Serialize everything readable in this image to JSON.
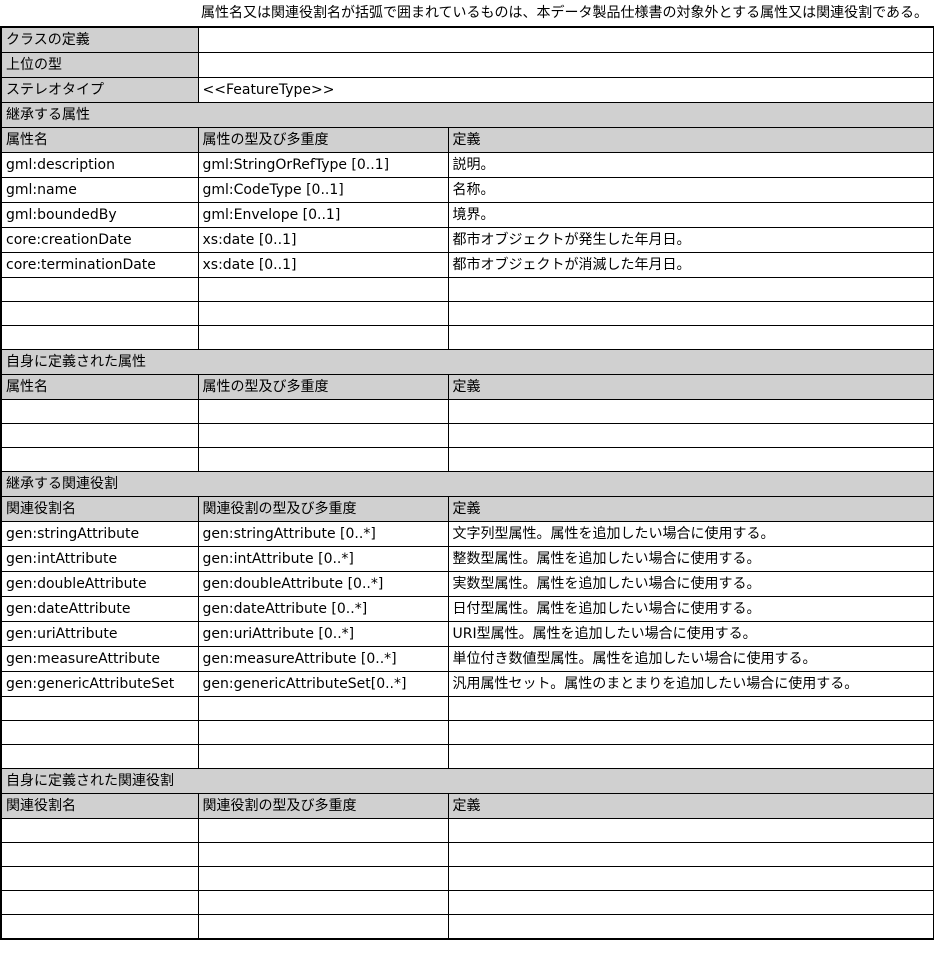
{
  "note": "属性名又は関連役割名が括弧で囲まれているものは、本データ製品仕様書の対象外とする属性又は関連役割である。",
  "class_definition_label": "クラスの定義",
  "class_definition_value": "",
  "supertype_label": "上位の型",
  "supertype_value": "",
  "stereotype_label": "ステレオタイプ",
  "stereotype_value": "<<FeatureType>>",
  "inherited_attributes": {
    "section_title": "継承する属性",
    "headers": [
      "属性名",
      "属性の型及び多重度",
      "定義"
    ],
    "rows": [
      [
        "gml:description",
        "gml:StringOrRefType [0..1]",
        "説明。"
      ],
      [
        "gml:name",
        "gml:CodeType [0..1]",
        "名称。"
      ],
      [
        "gml:boundedBy",
        "gml:Envelope [0..1]",
        "境界。"
      ],
      [
        "core:creationDate",
        "xs:date [0..1]",
        "都市オブジェクトが発生した年月日。"
      ],
      [
        "core:terminationDate",
        "xs:date [0..1]",
        "都市オブジェクトが消滅した年月日。"
      ],
      [
        "",
        "",
        ""
      ],
      [
        "",
        "",
        ""
      ],
      [
        "",
        "",
        ""
      ]
    ]
  },
  "own_attributes": {
    "section_title": "自身に定義された属性",
    "headers": [
      "属性名",
      "属性の型及び多重度",
      "定義"
    ],
    "rows": [
      [
        "",
        "",
        ""
      ],
      [
        "",
        "",
        ""
      ],
      [
        "",
        "",
        ""
      ]
    ]
  },
  "inherited_roles": {
    "section_title": "継承する関連役割",
    "headers": [
      "関連役割名",
      "関連役割の型及び多重度",
      "定義"
    ],
    "rows": [
      [
        "gen:stringAttribute",
        "gen:stringAttribute [0..*]",
        "文字列型属性。属性を追加したい場合に使用する。"
      ],
      [
        "gen:intAttribute",
        "gen:intAttribute [0..*]",
        "整数型属性。属性を追加したい場合に使用する。"
      ],
      [
        "gen:doubleAttribute",
        "gen:doubleAttribute [0..*]",
        "実数型属性。属性を追加したい場合に使用する。"
      ],
      [
        "gen:dateAttribute",
        "gen:dateAttribute [0..*]",
        "日付型属性。属性を追加したい場合に使用する。"
      ],
      [
        "gen:uriAttribute",
        "gen:uriAttribute [0..*]",
        "URI型属性。属性を追加したい場合に使用する。"
      ],
      [
        "gen:measureAttribute",
        "gen:measureAttribute [0..*]",
        "単位付き数値型属性。属性を追加したい場合に使用する。"
      ],
      [
        "gen:genericAttributeSet",
        "gen:genericAttributeSet[0..*]",
        "汎用属性セット。属性のまとまりを追加したい場合に使用する。"
      ],
      [
        "",
        "",
        ""
      ],
      [
        "",
        "",
        ""
      ],
      [
        "",
        "",
        ""
      ]
    ]
  },
  "own_roles": {
    "section_title": "自身に定義された関連役割",
    "headers": [
      "関連役割名",
      "関連役割の型及び多重度",
      "定義"
    ],
    "rows": [
      [
        "",
        "",
        ""
      ],
      [
        "",
        "",
        ""
      ],
      [
        "",
        "",
        ""
      ],
      [
        "",
        "",
        ""
      ],
      [
        "",
        "",
        ""
      ]
    ]
  }
}
